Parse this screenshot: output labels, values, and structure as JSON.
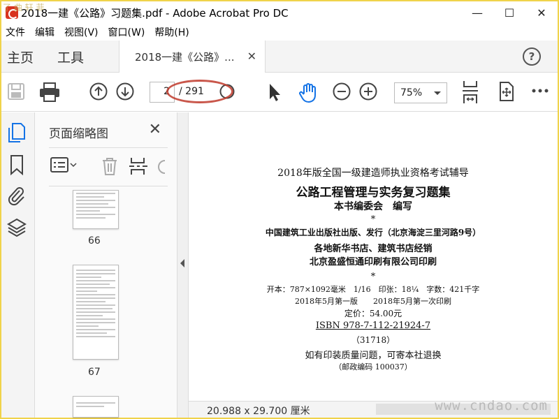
{
  "window": {
    "title": "2018一建《公路》习题集.pdf - Adobe Acrobat Pro DC",
    "minimize": "—",
    "maximize": "☐",
    "close": "✕",
    "corner_watermark": "了 曲 轩 菲"
  },
  "menu": [
    "文件",
    "编辑",
    "视图(V)",
    "窗口(W)",
    "帮助(H)"
  ],
  "tabs": {
    "home": "主页",
    "tools": "工具",
    "document": "2018一建《公路》...",
    "document_close": "✕",
    "help": "?"
  },
  "toolbar": {
    "current_page": "2",
    "total_pages": "/ 291",
    "zoom": "75%",
    "annotation_color": "#c0392b",
    "accent_color": "#1473e6"
  },
  "thumbnail_panel": {
    "title": "页面缩略图",
    "close": "✕",
    "thumbnails": [
      {
        "label": "66"
      },
      {
        "label": "67"
      }
    ]
  },
  "document": {
    "lines": [
      "2018年版全国一级建造师执业资格考试辅导",
      "公路工程管理与实务复习题集",
      "本书编委会　编写",
      "*",
      "中国建筑工业出版社出版、发行（北京海淀三里河路9号）",
      "各地新华书店、建筑书店经销",
      "北京盈盛恒通印刷有限公司印刷",
      "*",
      "开本：787×1092毫米　1/16　印张：18¼　字数：421千字",
      "2018年5月第一版　　2018年5月第一次印刷",
      "定价：54.00元",
      "ISBN 978-7-112-21924-7",
      "（31718）",
      "如有印装质量问题，可寄本社退换",
      "（邮政编码 100037）"
    ]
  },
  "status": {
    "page_size": "20.988 x 29.700 厘米",
    "watermark": "www.cndao.com"
  }
}
